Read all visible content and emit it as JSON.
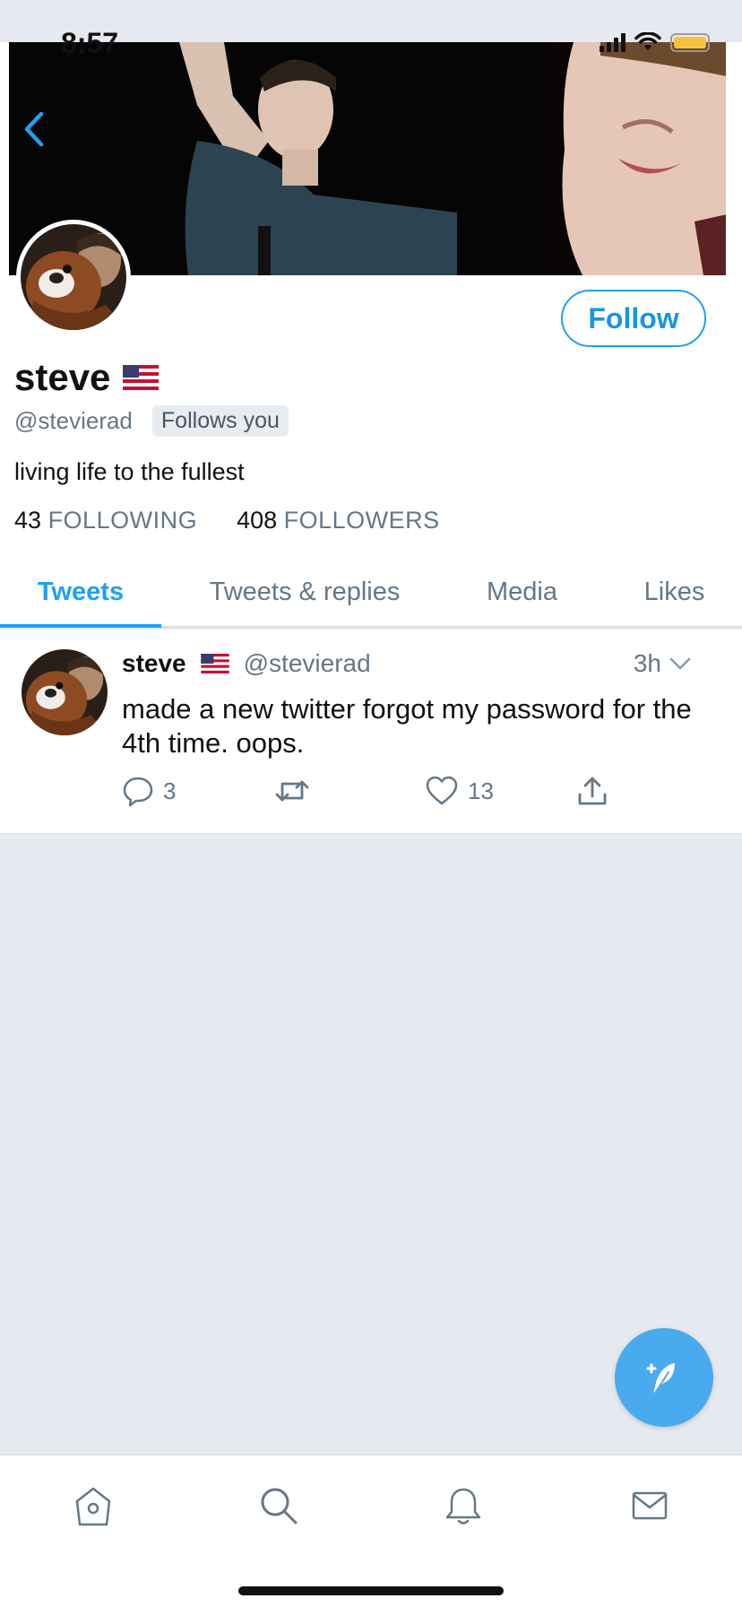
{
  "status_bar": {
    "time": "8:57"
  },
  "profile": {
    "display_name": "steve",
    "handle": "@stevierad",
    "follows_you": "Follows you",
    "bio": "living life to the fullest",
    "following_count": "43",
    "following_label": "FOLLOWING",
    "followers_count": "408",
    "followers_label": "FOLLOWERS",
    "follow_button": "Follow"
  },
  "tabs": [
    {
      "label": "Tweets",
      "active": true
    },
    {
      "label": "Tweets & replies",
      "active": false
    },
    {
      "label": "Media",
      "active": false
    },
    {
      "label": "Likes",
      "active": false
    }
  ],
  "tweet": {
    "name": "steve",
    "handle": "@stevierad",
    "time": "3h",
    "text": "made a new twitter forgot my password for the 4th time. oops.",
    "replies": "3",
    "retweets": "",
    "likes": "13"
  },
  "colors": {
    "accent": "#1da1f2",
    "muted": "#657786",
    "fab": "#4aaaee",
    "background": "#e6e9ef"
  },
  "icons": {
    "back": "chevron-left-icon",
    "reply": "speech-bubble-icon",
    "retweet": "retweet-icon",
    "like": "heart-icon",
    "share": "share-icon",
    "compose": "feather-plus-icon",
    "nav": [
      "home-icon",
      "search-icon",
      "bell-icon",
      "mail-icon"
    ]
  }
}
